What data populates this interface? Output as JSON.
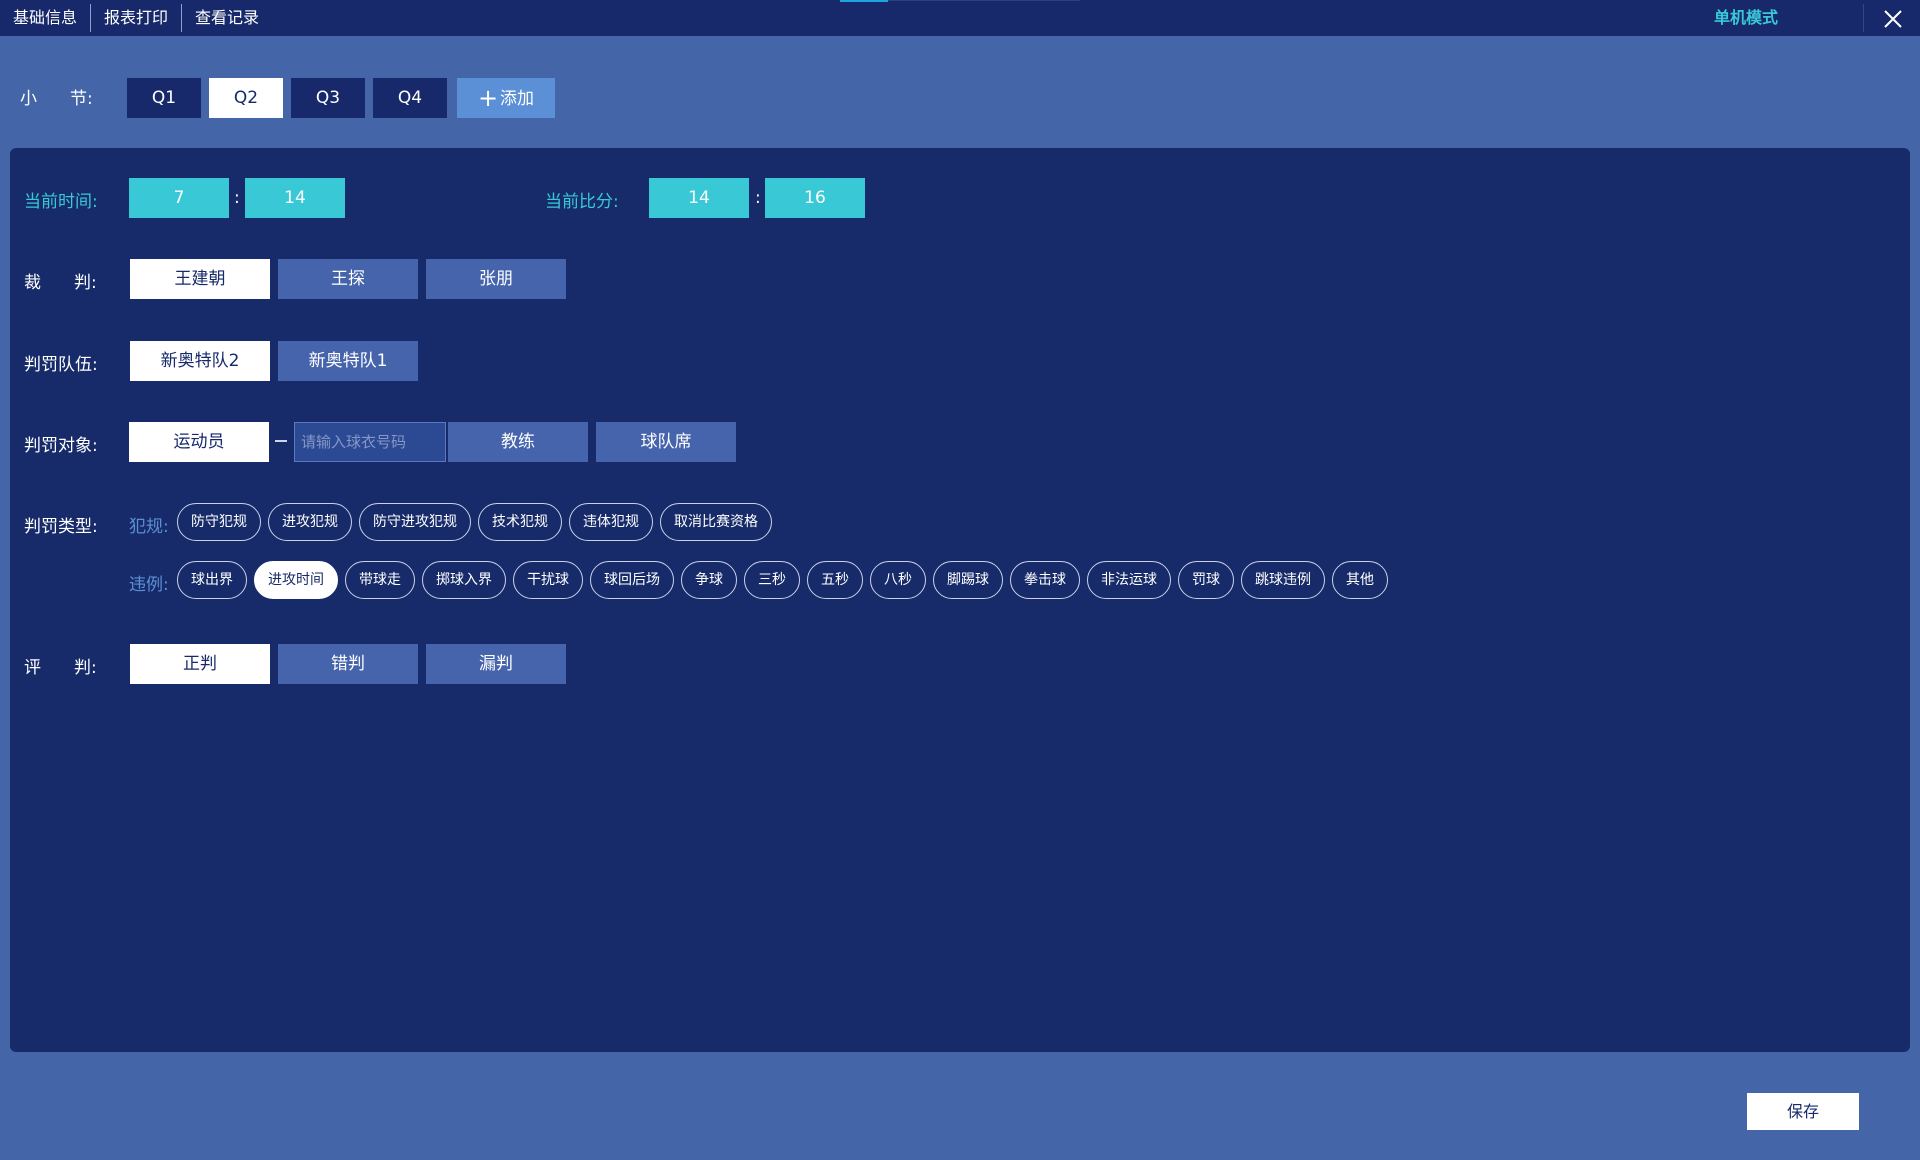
{
  "topbar": {
    "tabs": [
      "基础信息",
      "报表打印",
      "查看记录"
    ],
    "mode": "单机模式"
  },
  "quarters": {
    "label_a": "小",
    "label_b": "节:",
    "items": [
      "Q1",
      "Q2",
      "Q3",
      "Q4"
    ],
    "selected": "Q2",
    "add_label": "添加"
  },
  "current_time": {
    "label": "当前时间:",
    "minutes": "7",
    "seconds": "14",
    "sep": ":"
  },
  "current_score": {
    "label": "当前比分:",
    "home": "14",
    "away": "16",
    "sep": ":"
  },
  "referee": {
    "label_a": "裁",
    "label_b": "判:",
    "options": [
      "王建朝",
      "王探",
      "张朋"
    ],
    "selected": "王建朝"
  },
  "penalized_team": {
    "label": "判罚队伍:",
    "options": [
      "新奥特队2",
      "新奥特队1"
    ],
    "selected": "新奥特队2"
  },
  "penalty_target": {
    "label": "判罚对象:",
    "player_option": "运动员",
    "jersey_placeholder": "请输入球衣号码",
    "coach_option": "教练",
    "bench_option": "球队席",
    "selected": "运动员"
  },
  "penalty_type": {
    "label": "判罚类型:",
    "foul_label": "犯规:",
    "fouls": [
      "防守犯规",
      "进攻犯规",
      "防守进攻犯规",
      "技术犯规",
      "违体犯规",
      "取消比赛资格"
    ],
    "violation_label": "违例:",
    "violations": [
      "球出界",
      "进攻时间",
      "带球走",
      "掷球入界",
      "干扰球",
      "球回后场",
      "争球",
      "三秒",
      "五秒",
      "八秒",
      "脚踢球",
      "拳击球",
      "非法运球",
      "罚球",
      "跳球违例",
      "其他"
    ],
    "selected_violation": "进攻时间"
  },
  "judgment": {
    "label_a": "评",
    "label_b": "判:",
    "options": [
      "正判",
      "错判",
      "漏判"
    ],
    "selected": "正判"
  },
  "save_label": "保存"
}
